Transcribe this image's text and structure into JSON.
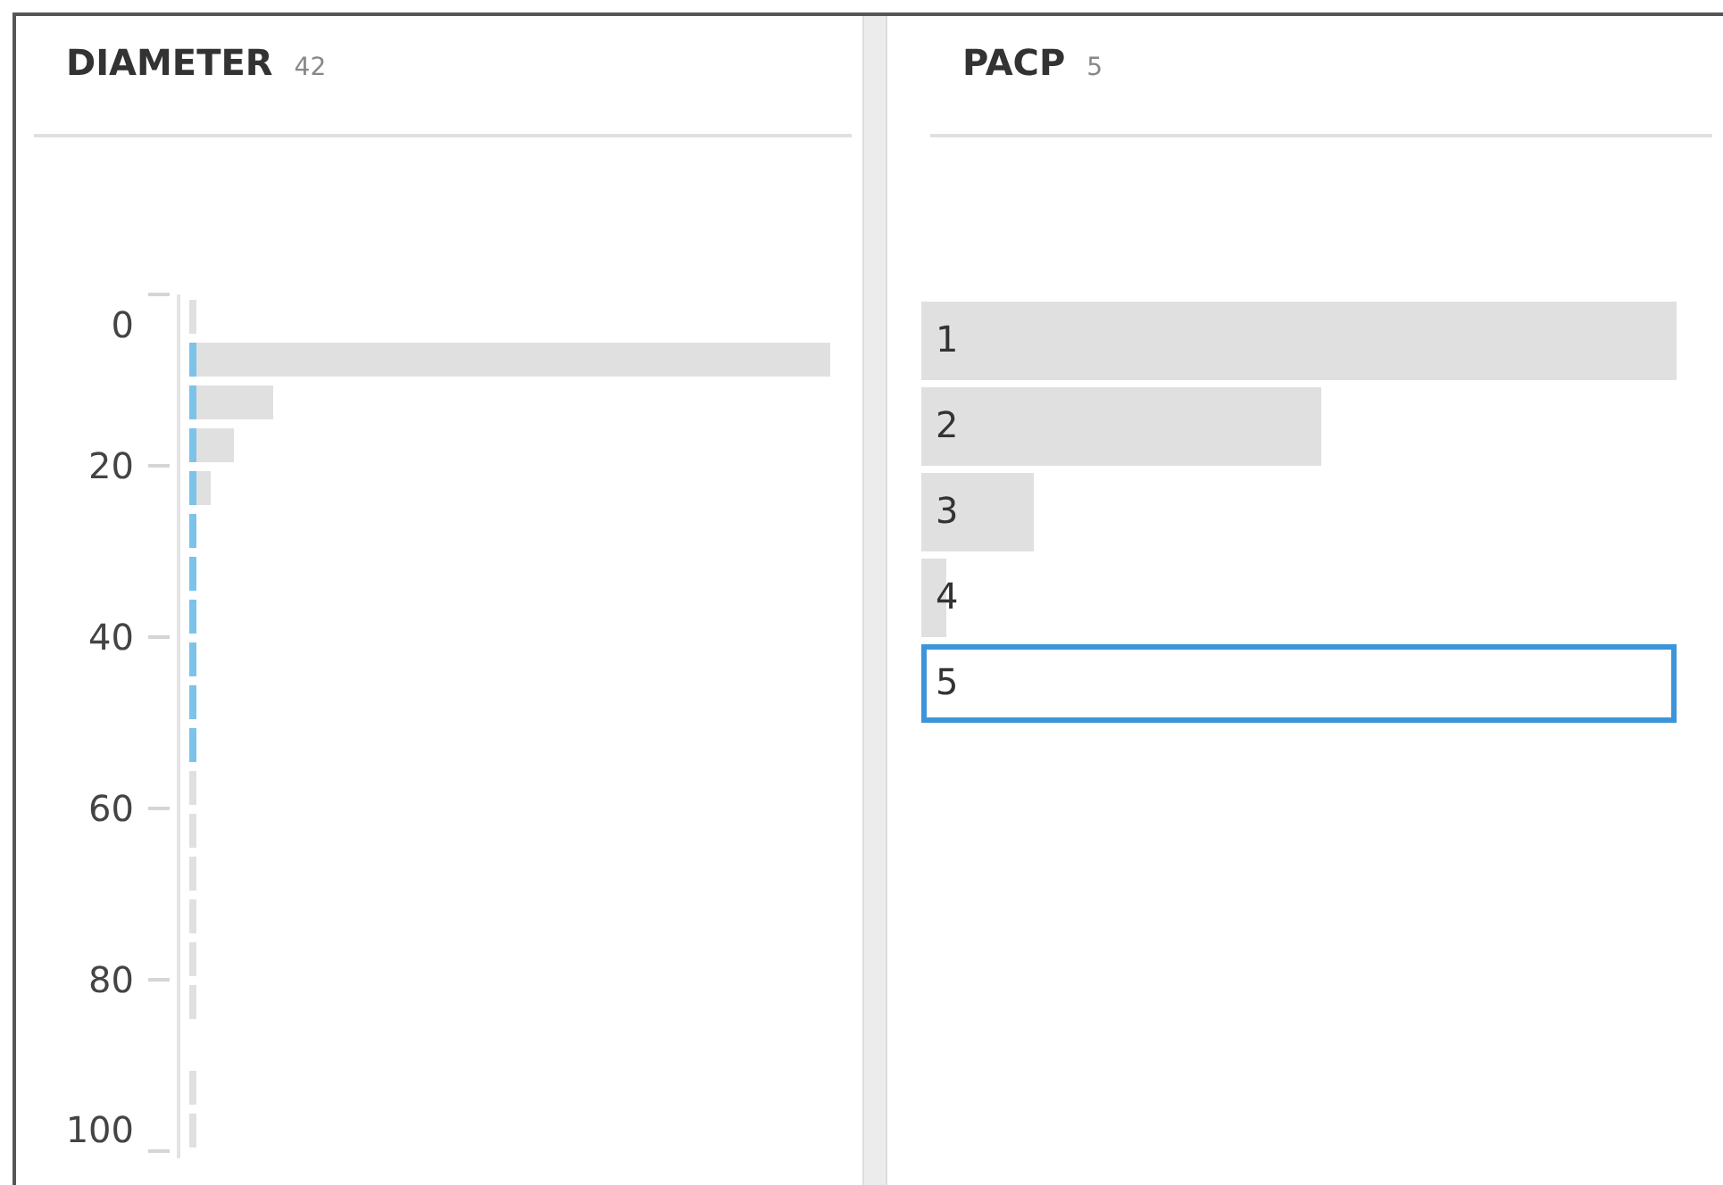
{
  "columns": [
    {
      "kind": "histogram",
      "title": "DIAMETER",
      "count": "42",
      "axis_ticks": [
        "0",
        "20",
        "40",
        "60",
        "80",
        "100"
      ]
    },
    {
      "kind": "values",
      "title": "PACP",
      "count": "5",
      "values": [
        {
          "label": "1",
          "level": 1,
          "selected": false
        },
        {
          "label": "2",
          "level": 0.53,
          "selected": false
        },
        {
          "label": "3",
          "level": 0.15,
          "selected": false
        },
        {
          "label": "4",
          "level": 0.033,
          "selected": false
        },
        {
          "label": "5",
          "selected": true
        }
      ]
    }
  ]
}
